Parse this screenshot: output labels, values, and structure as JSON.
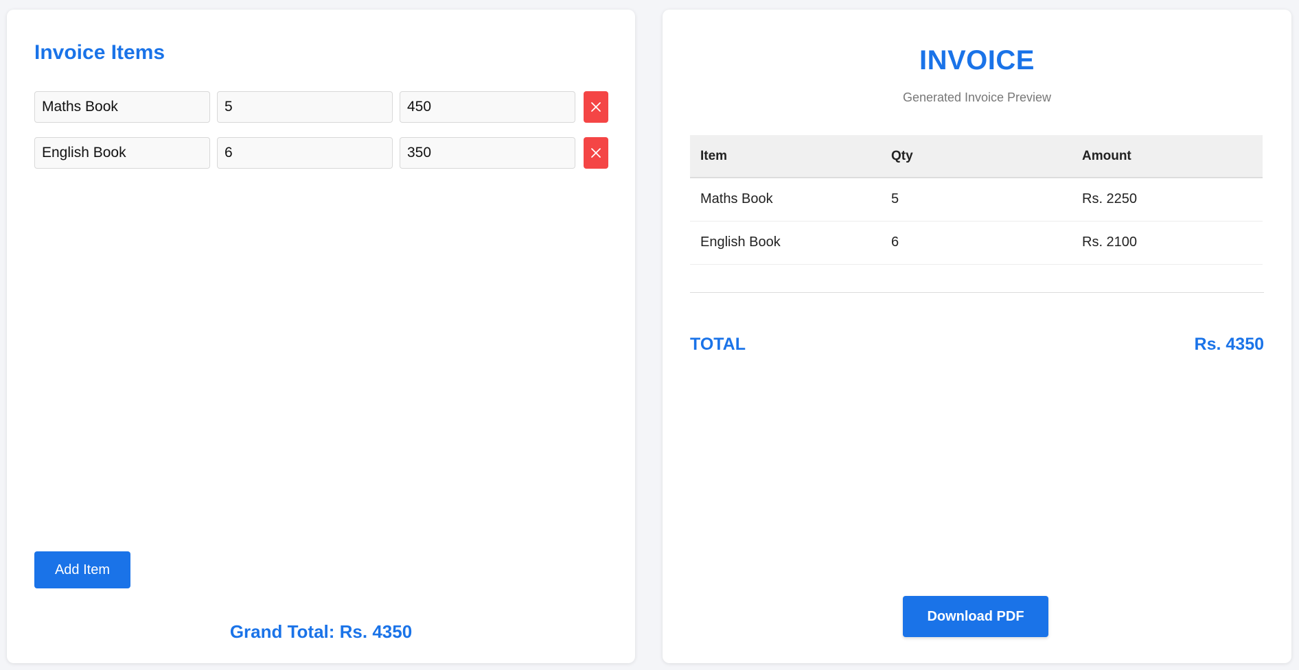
{
  "editor": {
    "title": "Invoice Items",
    "items": [
      {
        "name": "Maths Book",
        "qty": "5",
        "price": "450"
      },
      {
        "name": "English Book",
        "qty": "6",
        "price": "350"
      }
    ],
    "add_label": "Add Item",
    "grand_total": "Grand Total: Rs. 4350"
  },
  "preview": {
    "title": "INVOICE",
    "subtitle": "Generated Invoice Preview",
    "columns": [
      "Item",
      "Qty",
      "Amount"
    ],
    "rows": [
      [
        "Maths Book",
        "5",
        "Rs. 2250"
      ],
      [
        "English Book",
        "6",
        "Rs. 2100"
      ]
    ],
    "total_label": "TOTAL",
    "total_value": "Rs. 4350",
    "download_label": "Download PDF"
  },
  "icons": {
    "delete": "close-icon"
  },
  "colors": {
    "accent": "#1a73e8",
    "danger": "#f44545"
  }
}
